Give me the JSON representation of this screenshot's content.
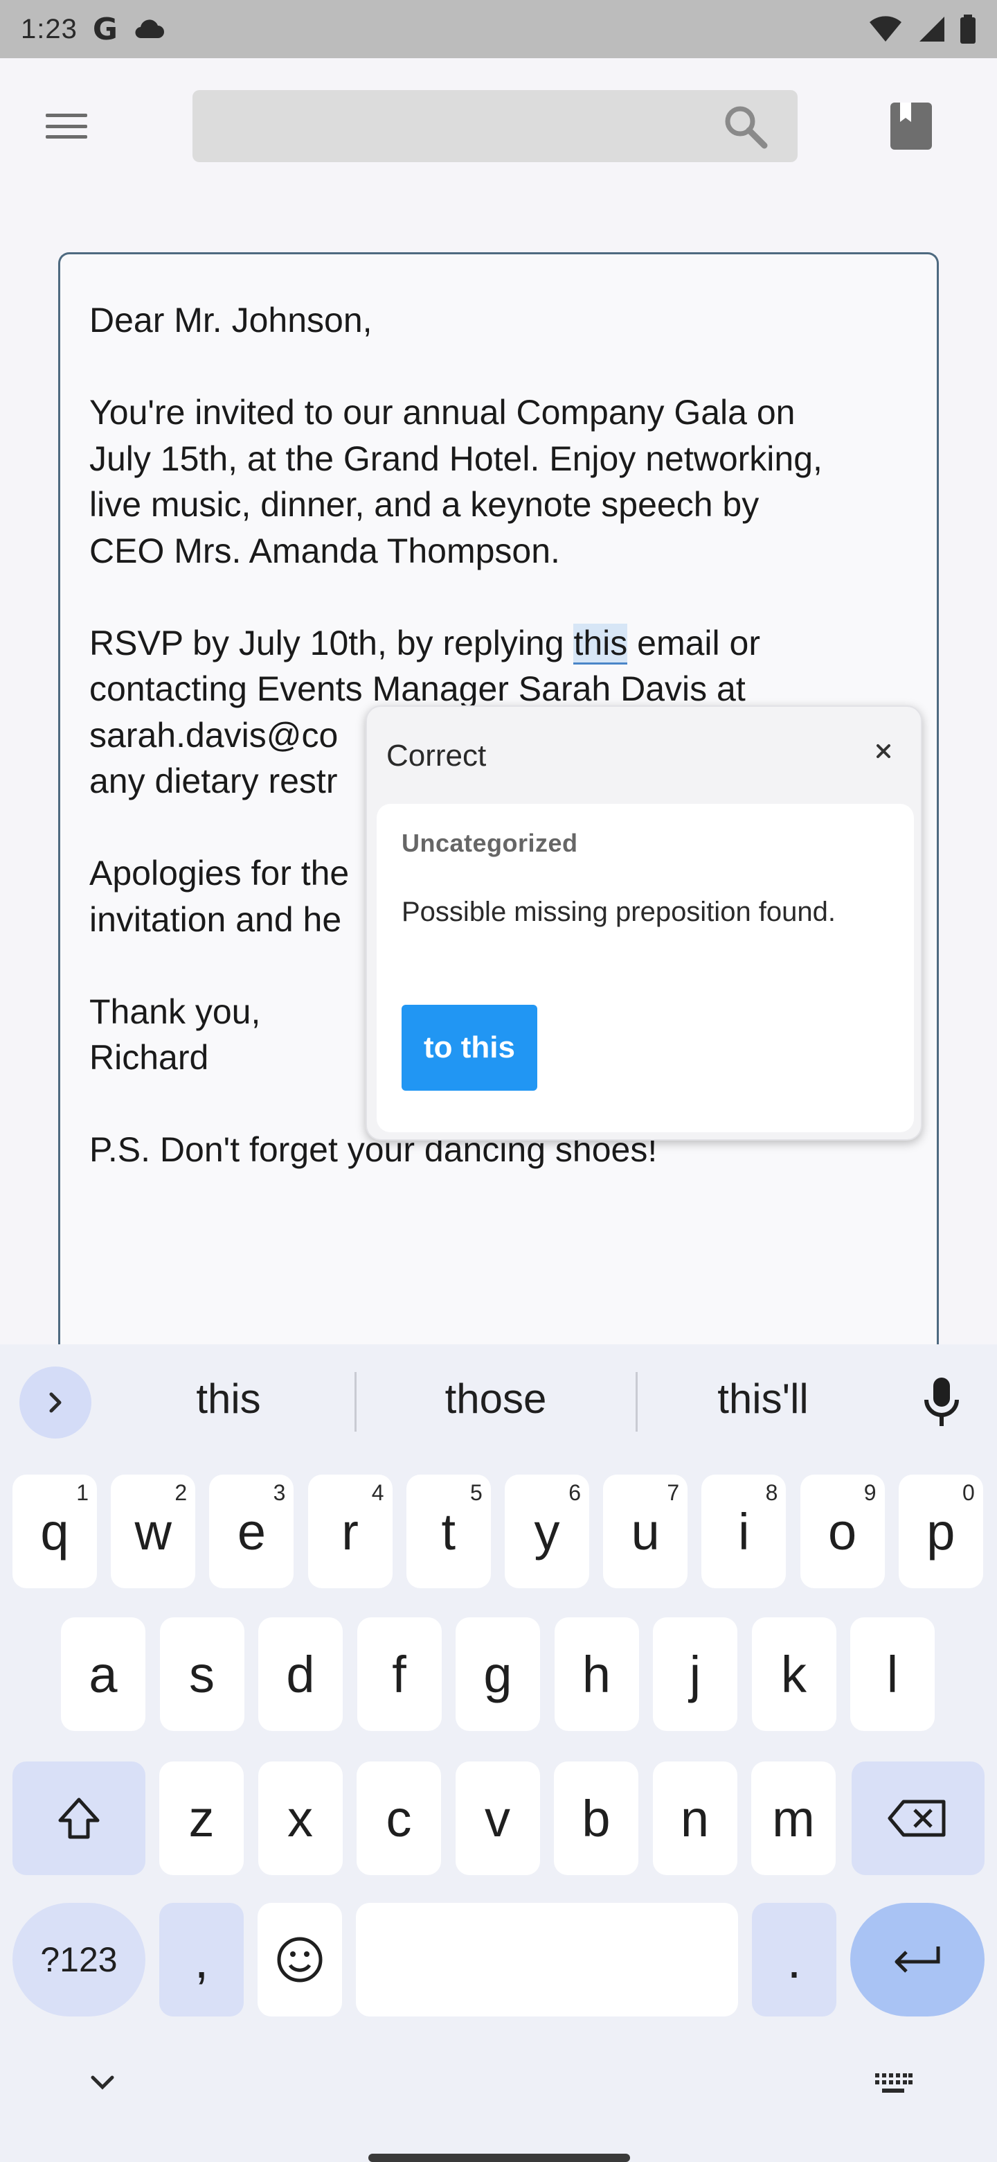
{
  "status_bar": {
    "time": "1:23"
  },
  "app_bar": {
    "search_placeholder": ""
  },
  "document": {
    "paragraphs": [
      {
        "lines": [
          "Dear Mr. Johnson,"
        ]
      },
      {
        "lines": [
          "You're invited to our annual Company Gala on",
          "July 15th, at the Grand Hotel. Enjoy networking,",
          "live music, dinner, and a keynote speech by",
          "CEO Mrs. Amanda Thompson."
        ]
      },
      {
        "lines": [
          "RSVP by July 10th, by replying ",
          "contacting Events Manager Sarah Davis at",
          "sarah.davis@co",
          "any dietary restr"
        ],
        "highlight": "this",
        "after_highlight": " email or"
      },
      {
        "lines": [
          "Apologies for the",
          "invitation and he"
        ]
      },
      {
        "lines": [
          "Thank you,",
          "Richard"
        ]
      },
      {
        "lines": [
          "P.S. Don't forget your dancing shoes!"
        ]
      }
    ]
  },
  "correction_popup": {
    "title": "Correct",
    "category": "Uncategorized",
    "message": "Possible missing preposition found.",
    "suggestion": "to this"
  },
  "keyboard": {
    "suggestions": [
      "this",
      "those",
      "this'll"
    ],
    "row1": [
      {
        "key": "q",
        "hint": "1"
      },
      {
        "key": "w",
        "hint": "2"
      },
      {
        "key": "e",
        "hint": "3"
      },
      {
        "key": "r",
        "hint": "4"
      },
      {
        "key": "t",
        "hint": "5"
      },
      {
        "key": "y",
        "hint": "6"
      },
      {
        "key": "u",
        "hint": "7"
      },
      {
        "key": "i",
        "hint": "8"
      },
      {
        "key": "o",
        "hint": "9"
      },
      {
        "key": "p",
        "hint": "0"
      }
    ],
    "row2": [
      "a",
      "s",
      "d",
      "f",
      "g",
      "h",
      "j",
      "k",
      "l"
    ],
    "row3": [
      "z",
      "x",
      "c",
      "v",
      "b",
      "n",
      "m"
    ],
    "symbols_label": "?123",
    "comma": ",",
    "period": "."
  },
  "colors": {
    "accent": "#2196f3",
    "editor_border": "#4e6a80",
    "keyboard_bg": "#eef0f7",
    "modifier_key": "#d9e0f7"
  },
  "icons": [
    "menu-icon",
    "search-icon",
    "bookmark-icon",
    "close-icon",
    "chevron-right-icon",
    "mic-icon",
    "shift-icon",
    "backspace-icon",
    "emoji-icon",
    "enter-icon",
    "chevron-down-icon",
    "keyboard-icon"
  ]
}
